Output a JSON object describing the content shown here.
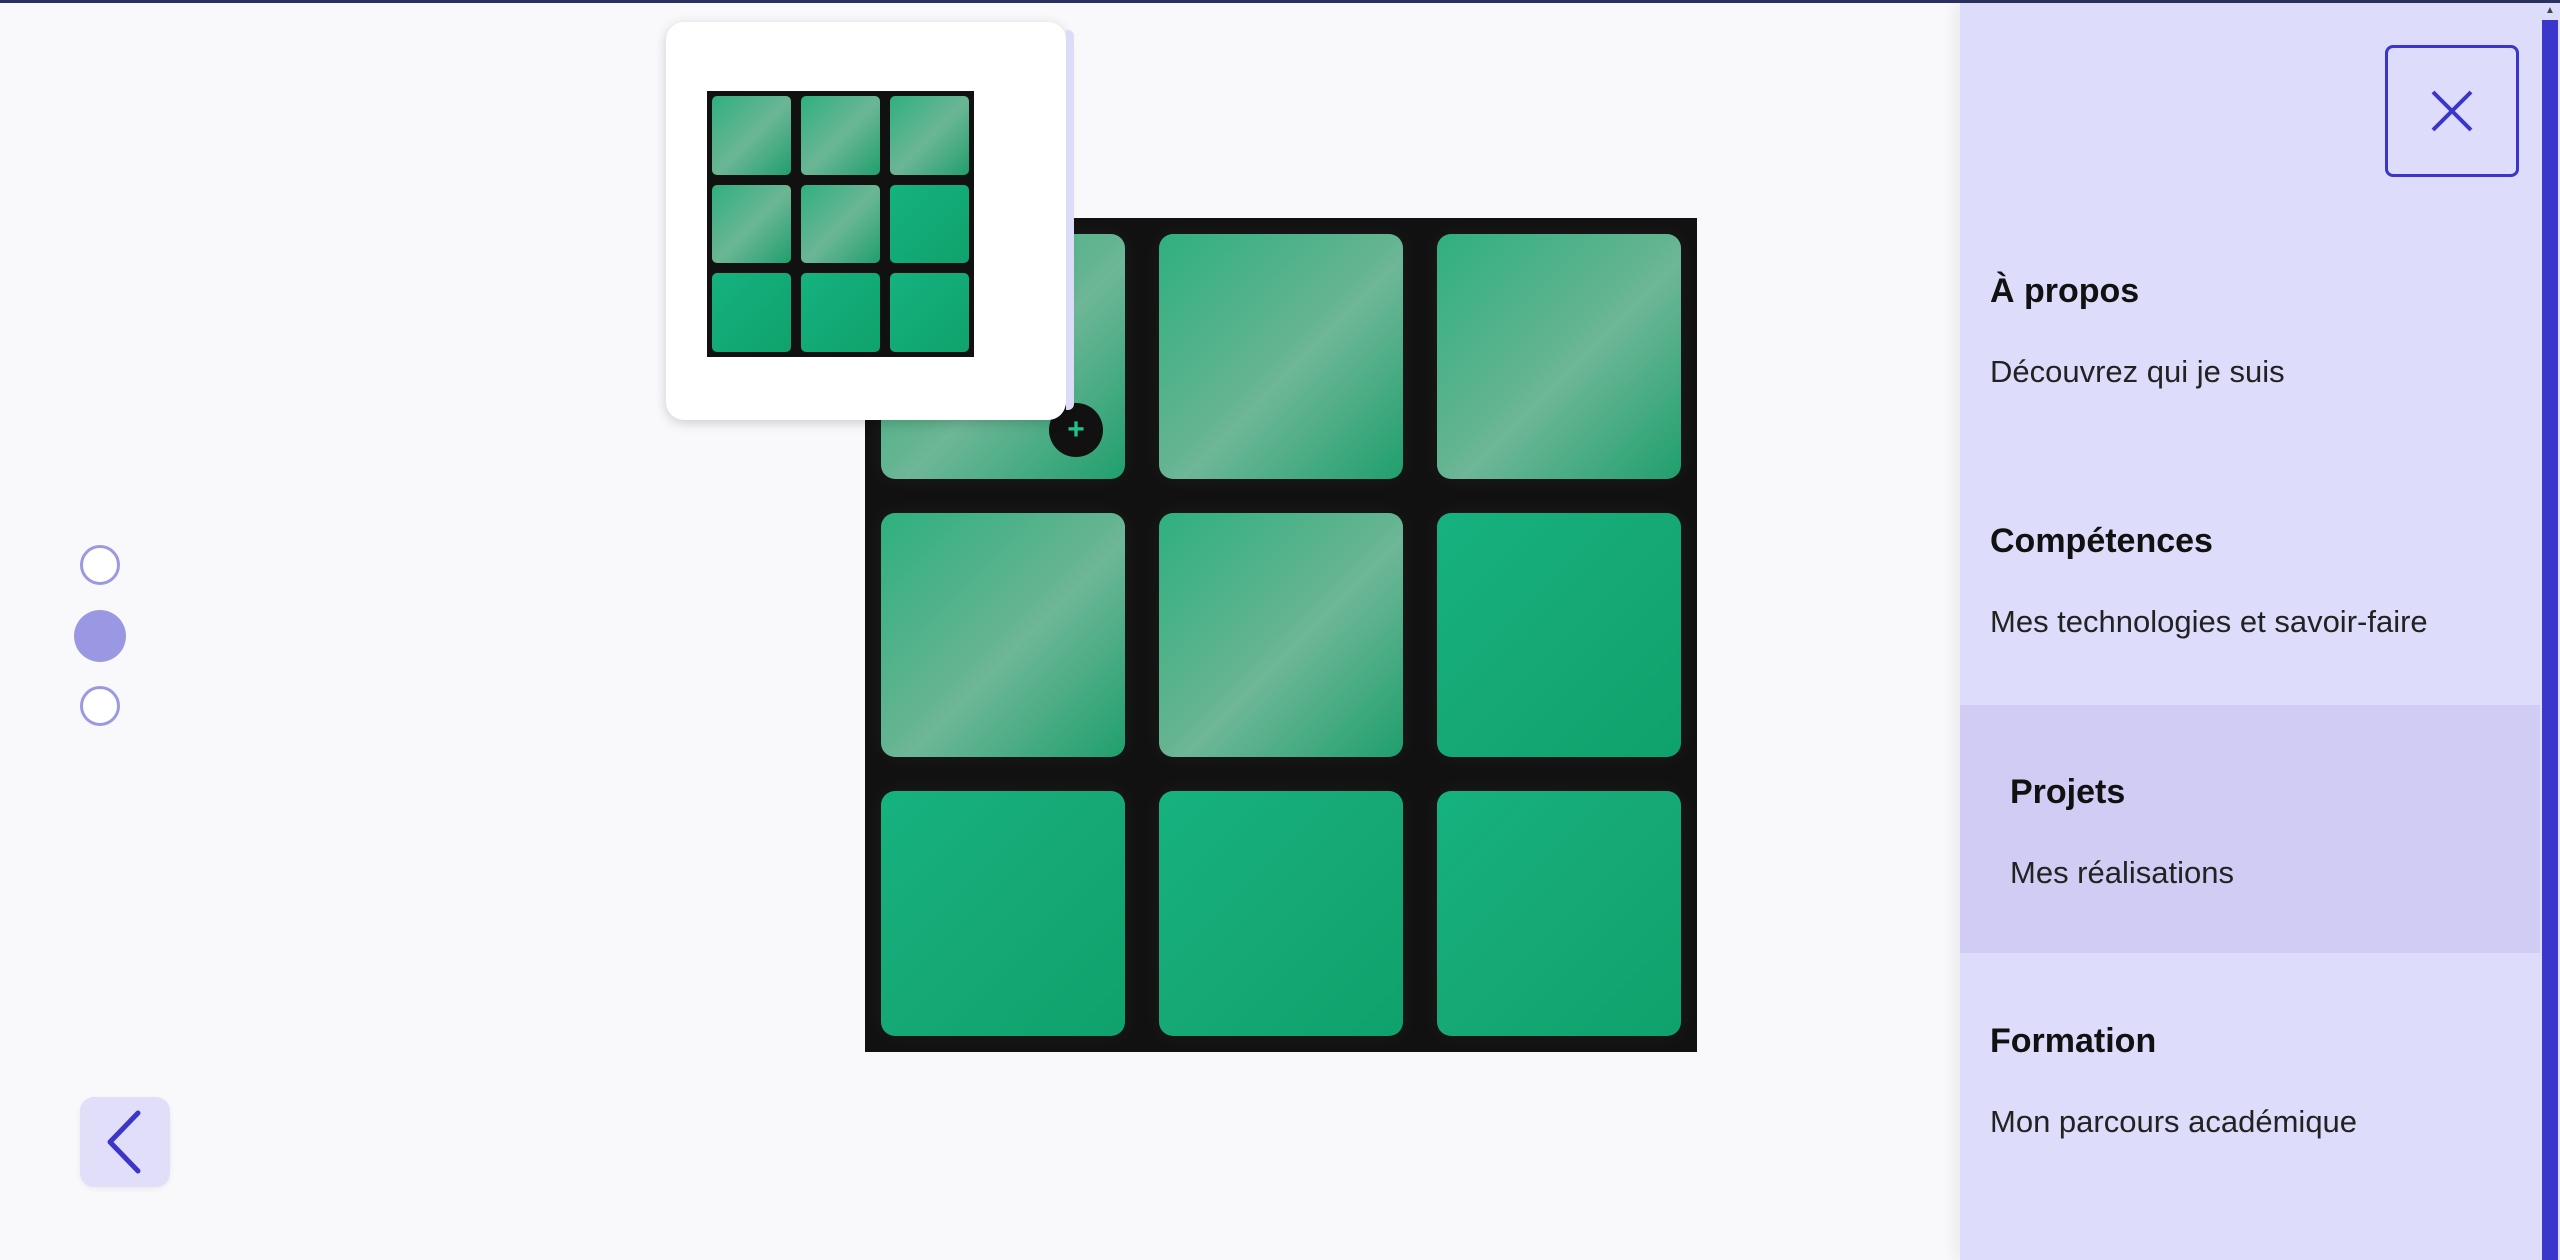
{
  "menu": {
    "items": [
      {
        "title": "À propos",
        "description": "Découvrez qui je suis",
        "active": false
      },
      {
        "title": "Compétences",
        "description": "Mes technologies et savoir-faire",
        "active": false
      },
      {
        "title": "Projets",
        "description": "Mes réalisations",
        "active": true
      },
      {
        "title": "Formation",
        "description": "Mon parcours académique",
        "active": false
      }
    ]
  },
  "pagination": {
    "count": 3,
    "active_index": 1
  },
  "board": {
    "tiles": [
      "light",
      "light",
      "light",
      "light",
      "light",
      "dark",
      "dark",
      "dark",
      "dark"
    ],
    "badge_symbol": "+"
  },
  "colors": {
    "accent": "#3b36c8",
    "menu_background": "#dddcfa",
    "menu_active": "#d0ccf4",
    "tile_green": "#15b27f",
    "board_background": "#111111"
  },
  "icons": {
    "close": "close-icon",
    "back": "chevron-left-icon",
    "badge": "plus-icon"
  }
}
